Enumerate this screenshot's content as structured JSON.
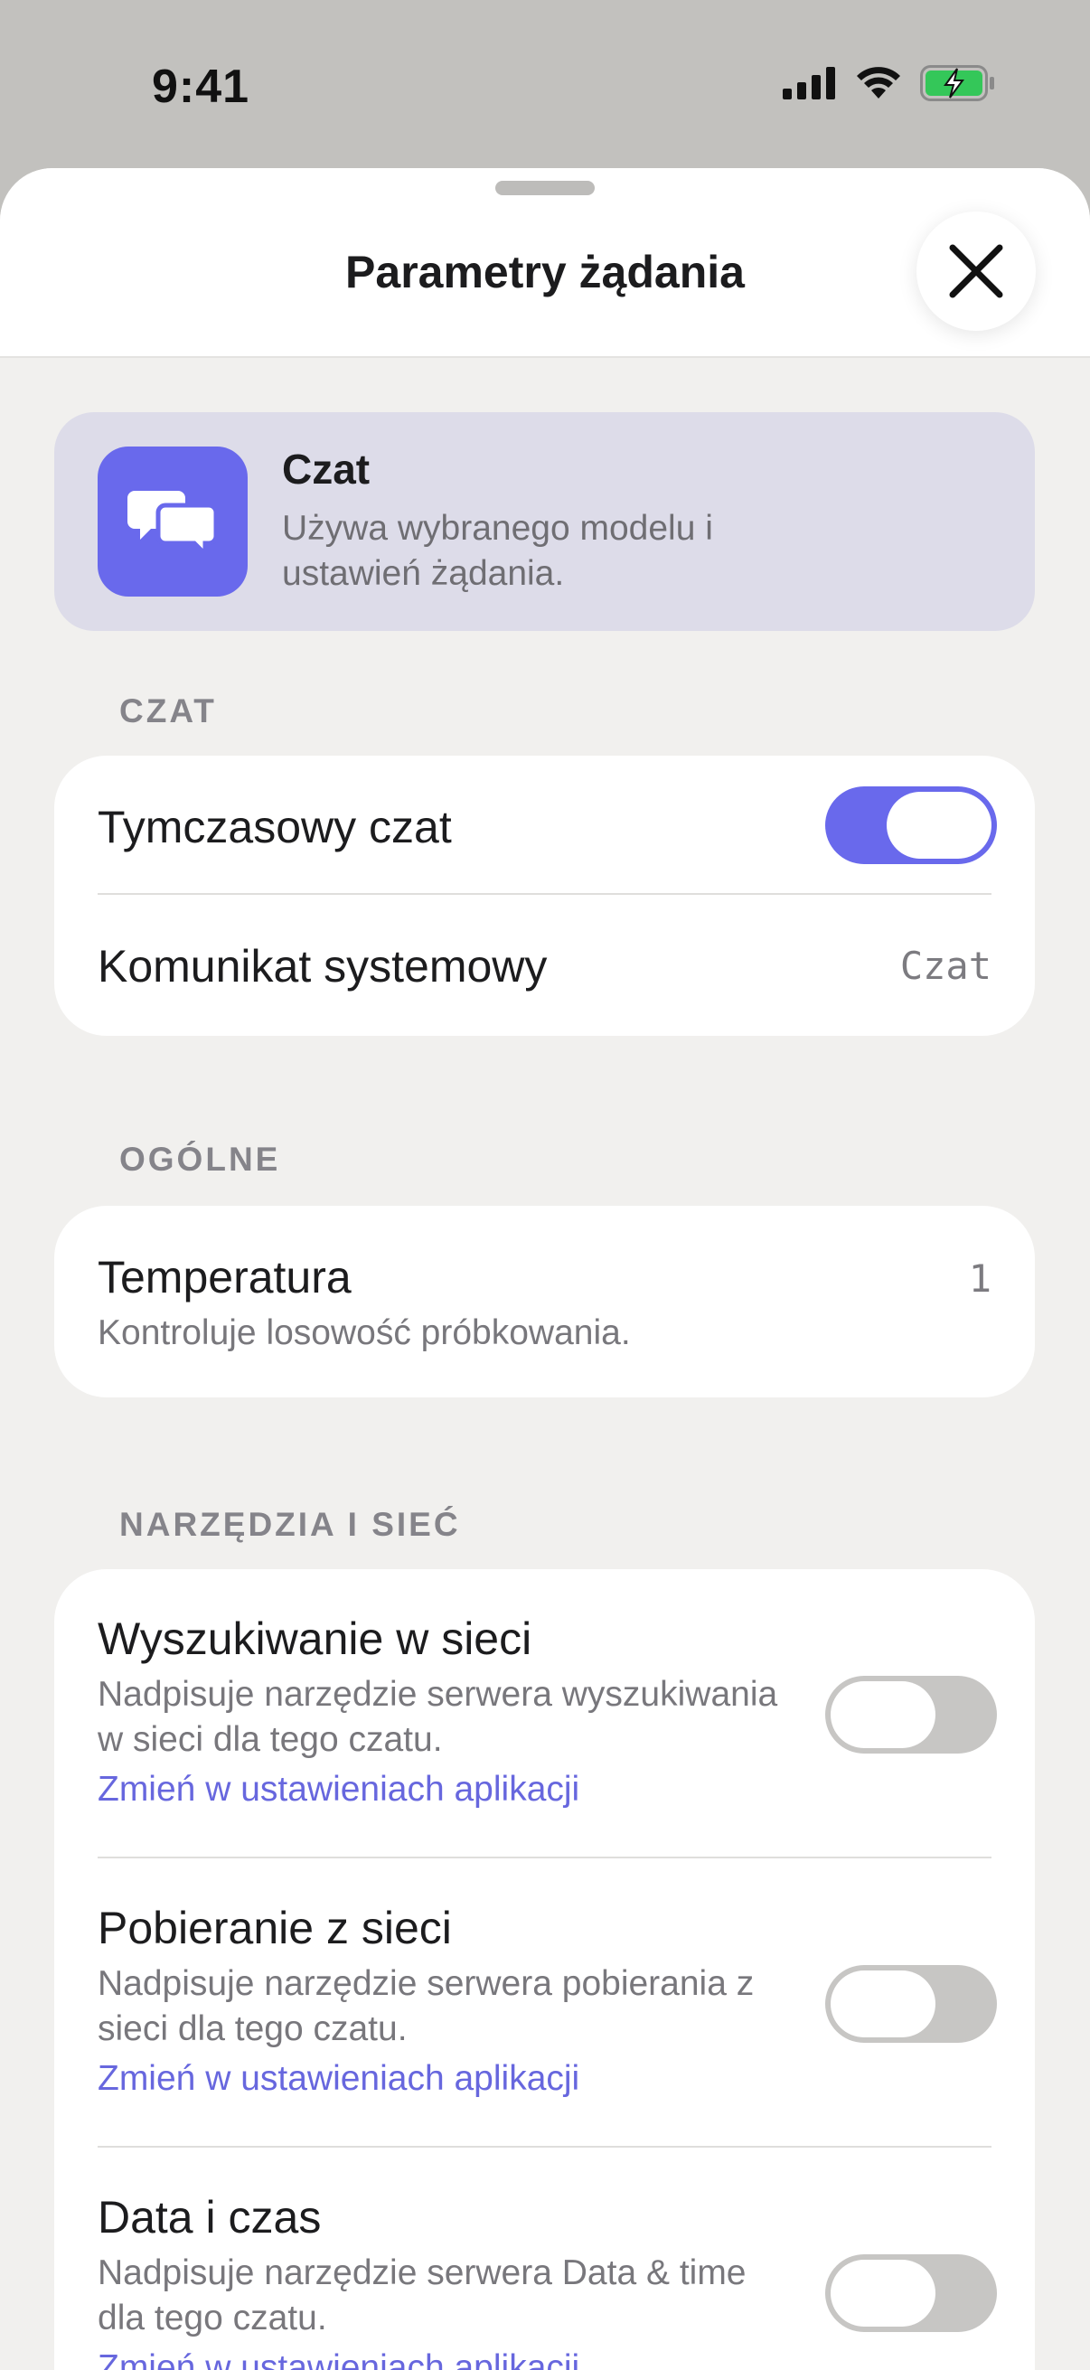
{
  "status_bar": {
    "time": "9:41"
  },
  "header": {
    "title": "Parametry żądania"
  },
  "mode": {
    "title": "Czat",
    "description": "Używa wybranego modelu i ustawień żądania.",
    "accent": "#6969ec"
  },
  "sections": {
    "chat": {
      "label": "CZAT",
      "temporary_chat": {
        "label": "Tymczasowy czat",
        "enabled": true
      },
      "system_message": {
        "label": "Komunikat systemowy",
        "value": "Czat"
      }
    },
    "general": {
      "label": "OGÓLNE",
      "temperature": {
        "label": "Temperatura",
        "description": "Kontroluje losowość próbkowania.",
        "value": "1"
      }
    },
    "tools": {
      "label": "NARZĘDZIA I SIEĆ",
      "items": [
        {
          "label": "Wyszukiwanie w sieci",
          "description": "Nadpisuje narzędzie serwera wyszukiwania w sieci dla tego czatu.",
          "link": "Zmień w ustawieniach aplikacji",
          "enabled": false
        },
        {
          "label": "Pobieranie z sieci",
          "description": "Nadpisuje narzędzie serwera pobierania z sieci dla tego czatu.",
          "link": "Zmień w ustawieniach aplikacji",
          "enabled": false
        },
        {
          "label": "Data i czas",
          "description": "Nadpisuje narzędzie serwera Data & time dla tego czatu.",
          "link": "Zmień w ustawieniach aplikacji",
          "enabled": false
        }
      ]
    }
  }
}
